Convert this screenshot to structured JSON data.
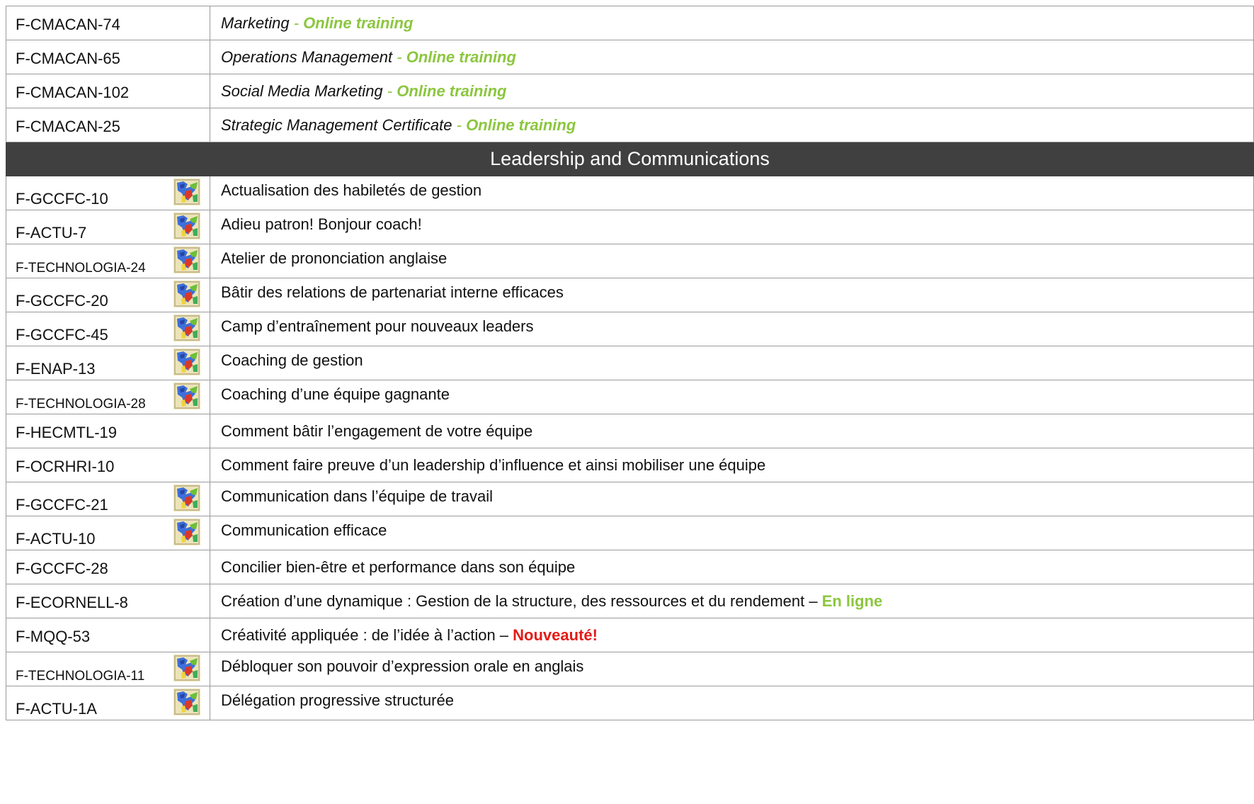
{
  "online_rows": [
    {
      "code": "F-CMACAN-74",
      "title": "Marketing",
      "sep": " - ",
      "tag": "Online  training"
    },
    {
      "code": "F-CMACAN-65",
      "title": "Operations Management",
      "sep": " - ",
      "tag": "Online  training"
    },
    {
      "code": "F-CMACAN-102",
      "title": "Social Media Marketing",
      "sep": " - ",
      "tag": "Online  training"
    },
    {
      "code": "F-CMACAN-25",
      "title": "Strategic Management Certificate",
      "sep": " - ",
      "tag": "Online  training"
    }
  ],
  "section": {
    "title": "Leadership and Communications"
  },
  "courses": [
    {
      "code": "F-GCCFC-10",
      "title": "Actualisation des habiletés de gestion",
      "icon": "quebec-flag-icon"
    },
    {
      "code": "F-ACTU-7",
      "title": "Adieu patron! Bonjour coach!",
      "icon": "quebec-flag-icon"
    },
    {
      "code": "F-TECHNOLOGIA-24",
      "title": "Atelier de prononciation anglaise",
      "icon": "quebec-flag-icon"
    },
    {
      "code": "F-GCCFC-20",
      "title": "Bâtir des relations de partenariat interne efficaces",
      "icon": "quebec-flag-icon"
    },
    {
      "code": "F-GCCFC-45",
      "title": "Camp d’entraînement pour nouveaux leaders",
      "icon": "quebec-flag-icon"
    },
    {
      "code": "F-ENAP-13",
      "title": "Coaching de gestion",
      "icon": "quebec-flag-icon"
    },
    {
      "code": "F-TECHNOLOGIA-28",
      "title": "Coaching d’une équipe gagnante",
      "icon": "quebec-flag-icon"
    },
    {
      "code": "F-HECMTL-19",
      "title": "Comment bâtir l’engagement de votre équipe"
    },
    {
      "code": "F-OCRHRI-10",
      "title": "Comment faire preuve d’un leadership d’influence et ainsi mobiliser une équipe"
    },
    {
      "code": "F-GCCFC-21",
      "title": "Communication dans l’équipe de travail",
      "icon": "quebec-flag-icon"
    },
    {
      "code": "F-ACTU-10",
      "title": "Communication efficace",
      "icon": "quebec-flag-icon"
    },
    {
      "code": "F-GCCFC-28",
      "title": "Concilier bien-être et performance dans son équipe"
    },
    {
      "code": "F-ECORNELL-8",
      "title": "Création d’une dynamique : Gestion de la structure, des ressources et du rendement – ",
      "tag": "En ligne"
    },
    {
      "code": "F-MQQ-53",
      "title": "Créativité appliquée : de l’idée à l’action – ",
      "badge": "Nouveauté!"
    },
    {
      "code": "F-TECHNOLOGIA-11",
      "title": "Débloquer son pouvoir d’expression orale en anglais",
      "icon": "quebec-flag-icon"
    },
    {
      "code": "F-ACTU-1A",
      "title": "Délégation progressive structurée",
      "icon": "quebec-flag-icon"
    }
  ],
  "colors": {
    "online_green": "#8cc63f",
    "new_red": "#e41b17",
    "section_bg": "#404040",
    "border": "#9a9a9a"
  }
}
